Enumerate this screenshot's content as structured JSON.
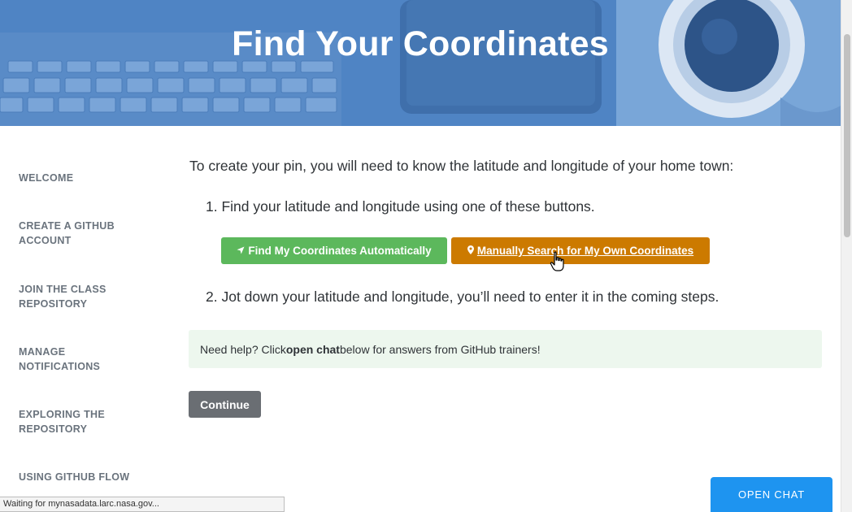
{
  "hero": {
    "title": "Find Your Coordinates",
    "background_color": "#4f84c4"
  },
  "sidebar": {
    "items": [
      {
        "label": "WELCOME"
      },
      {
        "label": "CREATE A GITHUB ACCOUNT"
      },
      {
        "label": "JOIN THE CLASS REPOSITORY"
      },
      {
        "label": "MANAGE NOTIFICATIONS"
      },
      {
        "label": "EXPLORING THE REPOSITORY"
      },
      {
        "label": "USING GITHUB FLOW"
      }
    ]
  },
  "main": {
    "intro": "To create your pin, you will need to know the latitude and longitude of your home town:",
    "step1": "1. Find your latitude and longitude using one of these buttons.",
    "auto_button": {
      "label": "Find My Coordinates Automatically",
      "icon": "location-arrow-icon",
      "color": "#5cb85c"
    },
    "manual_button": {
      "label": "Manually Search for My Own Coordinates",
      "icon": "map-pin-icon",
      "color": "#cc7a00"
    },
    "step2": "2. Jot down your latitude and longitude, you’ll need to enter it in the coming steps.",
    "help": {
      "prefix": "Need help? Click ",
      "bold": "open chat",
      "suffix": " below for answers from GitHub trainers!"
    },
    "continue_label": "Continue"
  },
  "chat": {
    "label": "OPEN CHAT",
    "color": "#1e94f0"
  },
  "status_bar": {
    "text": "Waiting for mynasadata.larc.nasa.gov..."
  }
}
